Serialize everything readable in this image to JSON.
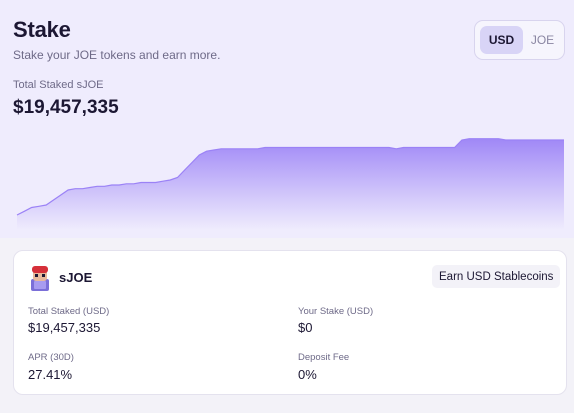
{
  "header": {
    "title": "Stake",
    "subtitle": "Stake your JOE tokens and earn more.",
    "total_label": "Total Staked sJOE",
    "total_value": "$19,457,335"
  },
  "currency_toggle": {
    "options": [
      "USD",
      "JOE"
    ],
    "selected": "USD"
  },
  "chart_data": {
    "type": "area",
    "title": "",
    "xlabel": "",
    "ylabel": "",
    "grid": false,
    "legend": "none",
    "color": "#9b82f6",
    "x": [
      0,
      1,
      2,
      3,
      4,
      5,
      6,
      7,
      8,
      9,
      10,
      11,
      12,
      13,
      14,
      15,
      16,
      17,
      18,
      19,
      20,
      21,
      22,
      23,
      24,
      25,
      26,
      27,
      28,
      29,
      30,
      31,
      32,
      33,
      34,
      35,
      36,
      37,
      38,
      39,
      40,
      41,
      42,
      43,
      44,
      45,
      46,
      47,
      48,
      49,
      50,
      51,
      52,
      53,
      54,
      55,
      56,
      57,
      58,
      59,
      60,
      61,
      62,
      63,
      64,
      65,
      66,
      67,
      68,
      69,
      70,
      71,
      72,
      73,
      74,
      75
    ],
    "values": [
      11.2,
      11.5,
      11.8,
      11.9,
      12.0,
      12.4,
      12.8,
      13.2,
      13.3,
      13.3,
      13.4,
      13.5,
      13.5,
      13.6,
      13.6,
      13.7,
      13.7,
      13.8,
      13.8,
      13.8,
      13.9,
      14.0,
      14.2,
      14.8,
      15.4,
      16.0,
      16.3,
      16.4,
      16.5,
      16.5,
      16.5,
      16.5,
      16.5,
      16.5,
      16.6,
      16.6,
      16.6,
      16.6,
      16.6,
      16.6,
      16.6,
      16.6,
      16.6,
      16.6,
      16.6,
      16.6,
      16.6,
      16.6,
      16.6,
      16.6,
      16.6,
      16.6,
      16.5,
      16.6,
      16.6,
      16.6,
      16.6,
      16.6,
      16.6,
      16.6,
      16.6,
      17.2,
      17.3,
      17.3,
      17.3,
      17.3,
      17.3,
      17.2,
      17.2,
      17.2,
      17.2,
      17.2,
      17.2,
      17.2,
      17.2,
      17.2
    ],
    "ylim": [
      10,
      18
    ]
  },
  "stake_card": {
    "token_icon": "joe-mascot-icon",
    "token_name": "sJOE",
    "earn_badge": "Earn USD Stablecoins",
    "stats": [
      {
        "label": "Total Staked (USD)",
        "value": "$19,457,335"
      },
      {
        "label": "Your Stake (USD)",
        "value": "$0"
      },
      {
        "label": "APR (30D)",
        "value": "27.41%"
      },
      {
        "label": "Deposit Fee",
        "value": "0%"
      }
    ]
  },
  "colors": {
    "hero_bg": "#efecfd",
    "accent": "#9b82f6",
    "toggle_selected": "#d8d4f6",
    "text_primary": "#1c1733",
    "text_secondary": "#6e6a88"
  }
}
